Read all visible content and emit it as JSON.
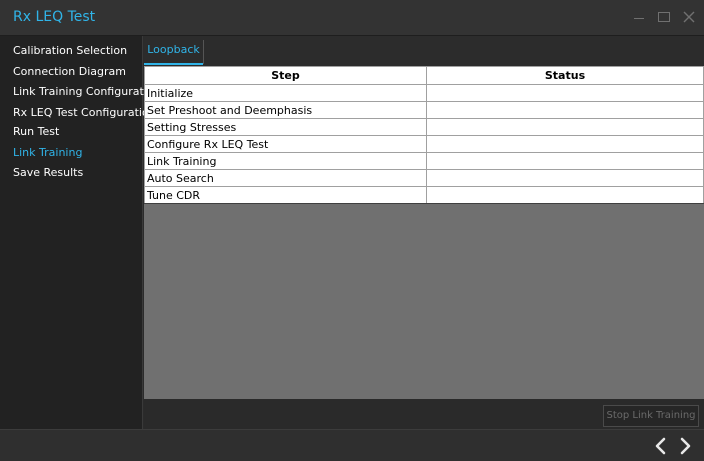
{
  "window": {
    "title": "Rx LEQ Test",
    "controls": {
      "minimize": "minimize-icon",
      "maximize": "maximize-icon",
      "close": "close-icon"
    }
  },
  "sidebar": {
    "items": [
      {
        "label": "Calibration Selection",
        "active": false
      },
      {
        "label": "Connection Diagram",
        "active": false
      },
      {
        "label": "Link Training Configuration",
        "active": false
      },
      {
        "label": "Rx LEQ Test Configuration",
        "active": false
      },
      {
        "label": "Run Test",
        "active": false
      },
      {
        "label": "Link Training",
        "active": true
      },
      {
        "label": "Save Results",
        "active": false
      }
    ]
  },
  "main": {
    "tabs": [
      {
        "label": "Loopback",
        "active": true
      }
    ],
    "table": {
      "columns": [
        "Step",
        "Status"
      ],
      "rows": [
        {
          "step": "Initialize",
          "status": ""
        },
        {
          "step": "Set Preshoot and Deemphasis",
          "status": ""
        },
        {
          "step": "Setting Stresses",
          "status": ""
        },
        {
          "step": "Configure Rx LEQ Test",
          "status": ""
        },
        {
          "step": "Link Training",
          "status": ""
        },
        {
          "step": "Auto Search",
          "status": ""
        },
        {
          "step": "Tune CDR",
          "status": ""
        }
      ]
    },
    "stop_button_label": "Stop Link Training"
  },
  "footer": {
    "prev_icon": "chevron-left-icon",
    "next_icon": "chevron-right-icon"
  },
  "colors": {
    "accent": "#30b4e8",
    "background": "#2b2b2b",
    "grid_empty": "#707070"
  }
}
